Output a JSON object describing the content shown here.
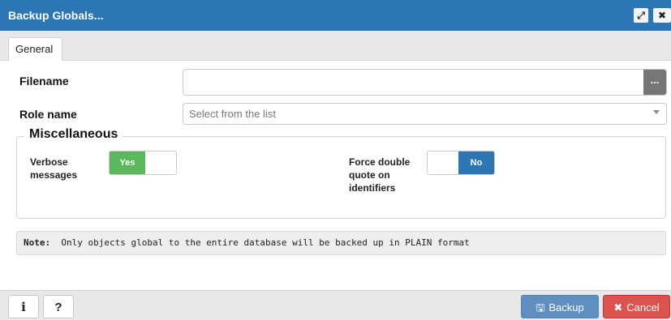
{
  "window": {
    "title": "Backup Globals...",
    "maximize_icon": "expand-icon",
    "close_icon": "close-icon",
    "maximize_glyph": "⤢",
    "close_glyph": "✖"
  },
  "tabs": [
    {
      "label": "General",
      "active": true
    }
  ],
  "form": {
    "filename": {
      "label": "Filename",
      "value": "",
      "browse_label": "..."
    },
    "role_name": {
      "label": "Role name",
      "placeholder": "Select from the list"
    }
  },
  "miscellaneous": {
    "legend": "Miscellaneous",
    "verbose": {
      "label": "Verbose messages",
      "value": "Yes",
      "on": true,
      "color": "#5cb85c"
    },
    "force_double_quote": {
      "label": "Force double quote on identifiers",
      "value": "No",
      "on": false,
      "color": "#2c76b4"
    }
  },
  "note": {
    "prefix": "Note:",
    "text": "Only objects global to the entire database will be backed up in PLAIN format"
  },
  "footer": {
    "info_glyph": "i",
    "help_glyph": "?",
    "backup_icon": "save-icon",
    "backup_glyph": "🖫",
    "backup_label": "Backup",
    "cancel_icon": "cross-icon",
    "cancel_glyph": "✖",
    "cancel_label": "Cancel"
  },
  "colors": {
    "titlebar": "#2c76b4",
    "yes_toggle": "#5cb85c",
    "no_toggle": "#2c76b4",
    "backup_button": "#5f8fc0",
    "cancel_button": "#d9534f"
  }
}
